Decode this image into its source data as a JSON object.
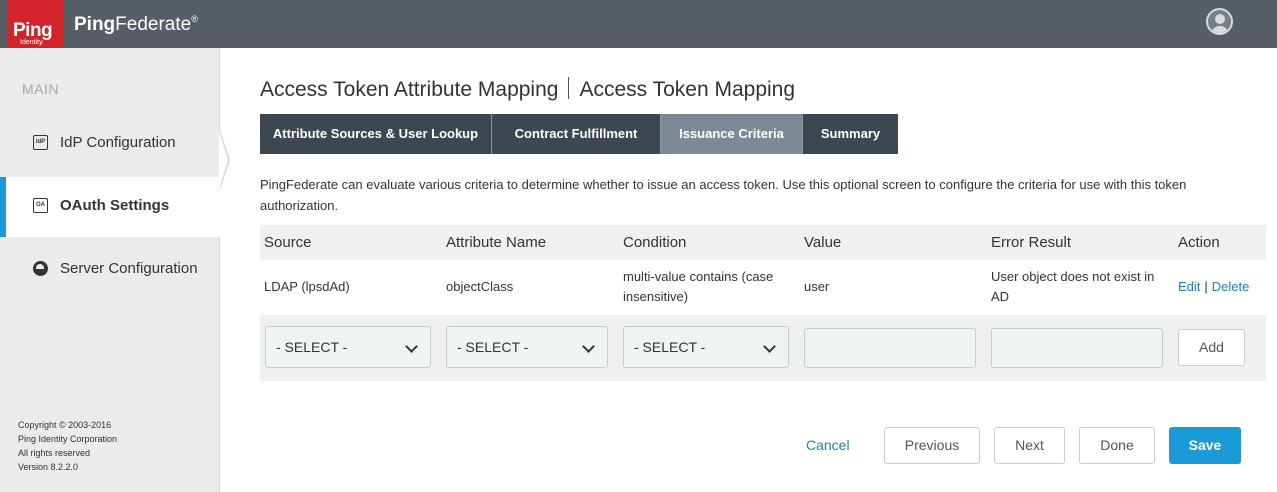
{
  "app": {
    "logo_text": "Ping",
    "logo_sub": "Identity.",
    "brand_bold": "Ping",
    "brand_rest": "Federate",
    "brand_reg": "®"
  },
  "sidebar": {
    "heading": "MAIN",
    "items": [
      {
        "label": "IdP Configuration",
        "icon": "IdP"
      },
      {
        "label": "OAuth Settings",
        "icon": "OA"
      },
      {
        "label": "Server Configuration",
        "icon": "server-icon"
      }
    ],
    "copyright": [
      "Copyright © 2003-2016",
      "Ping Identity Corporation",
      "All rights reserved",
      "Version 8.2.2.0"
    ]
  },
  "page": {
    "title_left": "Access Token Attribute Mapping",
    "title_right": "Access Token Mapping",
    "tabs": [
      {
        "label": "Attribute Sources & User Lookup"
      },
      {
        "label": "Contract Fulfillment"
      },
      {
        "label": "Issuance Criteria"
      },
      {
        "label": "Summary"
      }
    ],
    "intro": "PingFederate can evaluate various criteria to determine whether to issue an access token. Use this optional screen to configure the criteria for use with this token authorization."
  },
  "table": {
    "headers": [
      "Source",
      "Attribute Name",
      "Condition",
      "Value",
      "Error Result",
      "Action"
    ],
    "rows": [
      {
        "source": "LDAP (lpsdAd)",
        "attribute": "objectClass",
        "condition": "multi-value contains (case insensitive)",
        "value": "user",
        "error": "User object does not exist in AD",
        "edit": "Edit",
        "delete": "Delete"
      }
    ],
    "new_row": {
      "source_select": "- SELECT -",
      "attribute_select": "- SELECT -",
      "condition_select": "- SELECT -",
      "value": "",
      "error": "",
      "add_label": "Add"
    }
  },
  "footer": {
    "cancel": "Cancel",
    "previous": "Previous",
    "next": "Next",
    "done": "Done",
    "save": "Save"
  },
  "colors": {
    "topbar": "#575e65",
    "logo_red": "#d4232b",
    "tab_dark": "#3d4751",
    "tab_active": "#7d8a96",
    "accent": "#1a9bd7",
    "link": "#1a7fc0"
  }
}
